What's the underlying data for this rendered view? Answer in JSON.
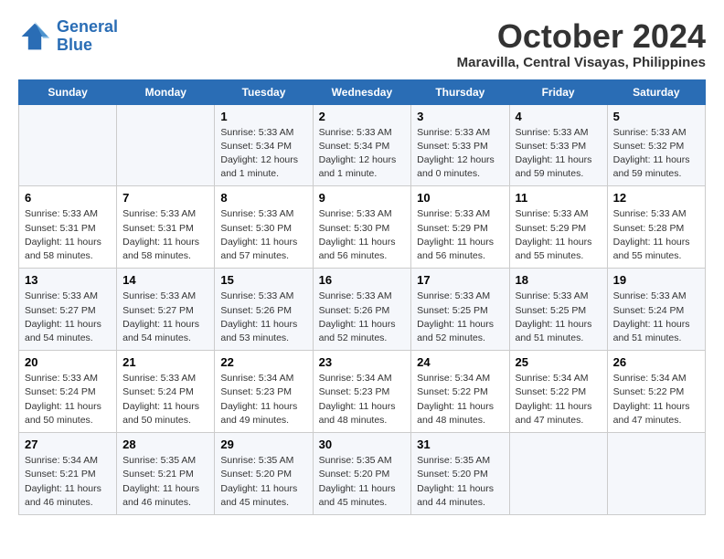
{
  "header": {
    "logo_line1": "General",
    "logo_line2": "Blue",
    "month": "October 2024",
    "location": "Maravilla, Central Visayas, Philippines"
  },
  "days_of_week": [
    "Sunday",
    "Monday",
    "Tuesday",
    "Wednesday",
    "Thursday",
    "Friday",
    "Saturday"
  ],
  "weeks": [
    [
      {
        "day": "",
        "info": ""
      },
      {
        "day": "",
        "info": ""
      },
      {
        "day": "1",
        "info": "Sunrise: 5:33 AM\nSunset: 5:34 PM\nDaylight: 12 hours and 1 minute."
      },
      {
        "day": "2",
        "info": "Sunrise: 5:33 AM\nSunset: 5:34 PM\nDaylight: 12 hours and 1 minute."
      },
      {
        "day": "3",
        "info": "Sunrise: 5:33 AM\nSunset: 5:33 PM\nDaylight: 12 hours and 0 minutes."
      },
      {
        "day": "4",
        "info": "Sunrise: 5:33 AM\nSunset: 5:33 PM\nDaylight: 11 hours and 59 minutes."
      },
      {
        "day": "5",
        "info": "Sunrise: 5:33 AM\nSunset: 5:32 PM\nDaylight: 11 hours and 59 minutes."
      }
    ],
    [
      {
        "day": "6",
        "info": "Sunrise: 5:33 AM\nSunset: 5:31 PM\nDaylight: 11 hours and 58 minutes."
      },
      {
        "day": "7",
        "info": "Sunrise: 5:33 AM\nSunset: 5:31 PM\nDaylight: 11 hours and 58 minutes."
      },
      {
        "day": "8",
        "info": "Sunrise: 5:33 AM\nSunset: 5:30 PM\nDaylight: 11 hours and 57 minutes."
      },
      {
        "day": "9",
        "info": "Sunrise: 5:33 AM\nSunset: 5:30 PM\nDaylight: 11 hours and 56 minutes."
      },
      {
        "day": "10",
        "info": "Sunrise: 5:33 AM\nSunset: 5:29 PM\nDaylight: 11 hours and 56 minutes."
      },
      {
        "day": "11",
        "info": "Sunrise: 5:33 AM\nSunset: 5:29 PM\nDaylight: 11 hours and 55 minutes."
      },
      {
        "day": "12",
        "info": "Sunrise: 5:33 AM\nSunset: 5:28 PM\nDaylight: 11 hours and 55 minutes."
      }
    ],
    [
      {
        "day": "13",
        "info": "Sunrise: 5:33 AM\nSunset: 5:27 PM\nDaylight: 11 hours and 54 minutes."
      },
      {
        "day": "14",
        "info": "Sunrise: 5:33 AM\nSunset: 5:27 PM\nDaylight: 11 hours and 54 minutes."
      },
      {
        "day": "15",
        "info": "Sunrise: 5:33 AM\nSunset: 5:26 PM\nDaylight: 11 hours and 53 minutes."
      },
      {
        "day": "16",
        "info": "Sunrise: 5:33 AM\nSunset: 5:26 PM\nDaylight: 11 hours and 52 minutes."
      },
      {
        "day": "17",
        "info": "Sunrise: 5:33 AM\nSunset: 5:25 PM\nDaylight: 11 hours and 52 minutes."
      },
      {
        "day": "18",
        "info": "Sunrise: 5:33 AM\nSunset: 5:25 PM\nDaylight: 11 hours and 51 minutes."
      },
      {
        "day": "19",
        "info": "Sunrise: 5:33 AM\nSunset: 5:24 PM\nDaylight: 11 hours and 51 minutes."
      }
    ],
    [
      {
        "day": "20",
        "info": "Sunrise: 5:33 AM\nSunset: 5:24 PM\nDaylight: 11 hours and 50 minutes."
      },
      {
        "day": "21",
        "info": "Sunrise: 5:33 AM\nSunset: 5:24 PM\nDaylight: 11 hours and 50 minutes."
      },
      {
        "day": "22",
        "info": "Sunrise: 5:34 AM\nSunset: 5:23 PM\nDaylight: 11 hours and 49 minutes."
      },
      {
        "day": "23",
        "info": "Sunrise: 5:34 AM\nSunset: 5:23 PM\nDaylight: 11 hours and 48 minutes."
      },
      {
        "day": "24",
        "info": "Sunrise: 5:34 AM\nSunset: 5:22 PM\nDaylight: 11 hours and 48 minutes."
      },
      {
        "day": "25",
        "info": "Sunrise: 5:34 AM\nSunset: 5:22 PM\nDaylight: 11 hours and 47 minutes."
      },
      {
        "day": "26",
        "info": "Sunrise: 5:34 AM\nSunset: 5:22 PM\nDaylight: 11 hours and 47 minutes."
      }
    ],
    [
      {
        "day": "27",
        "info": "Sunrise: 5:34 AM\nSunset: 5:21 PM\nDaylight: 11 hours and 46 minutes."
      },
      {
        "day": "28",
        "info": "Sunrise: 5:35 AM\nSunset: 5:21 PM\nDaylight: 11 hours and 46 minutes."
      },
      {
        "day": "29",
        "info": "Sunrise: 5:35 AM\nSunset: 5:20 PM\nDaylight: 11 hours and 45 minutes."
      },
      {
        "day": "30",
        "info": "Sunrise: 5:35 AM\nSunset: 5:20 PM\nDaylight: 11 hours and 45 minutes."
      },
      {
        "day": "31",
        "info": "Sunrise: 5:35 AM\nSunset: 5:20 PM\nDaylight: 11 hours and 44 minutes."
      },
      {
        "day": "",
        "info": ""
      },
      {
        "day": "",
        "info": ""
      }
    ]
  ]
}
